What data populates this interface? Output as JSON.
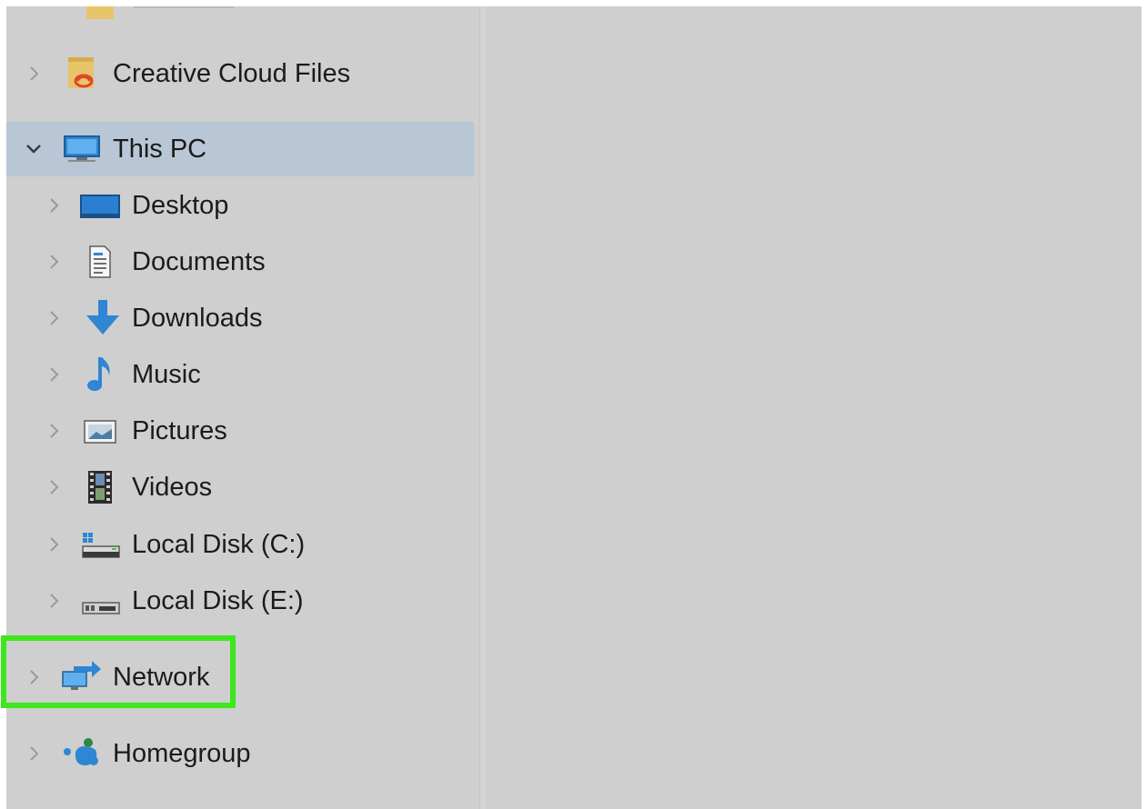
{
  "nav": {
    "partial_item": {
      "icon": "folder-icon"
    },
    "creative_cloud": {
      "label": "Creative Cloud Files",
      "icon": "creative-cloud-folder-icon"
    },
    "this_pc": {
      "label": "This PC",
      "icon": "monitor-icon",
      "expanded": true,
      "selected": true
    },
    "children": [
      {
        "label": "Desktop",
        "icon": "desktop-icon"
      },
      {
        "label": "Documents",
        "icon": "documents-icon"
      },
      {
        "label": "Downloads",
        "icon": "download-arrow-icon"
      },
      {
        "label": "Music",
        "icon": "music-note-icon"
      },
      {
        "label": "Pictures",
        "icon": "pictures-icon"
      },
      {
        "label": "Videos",
        "icon": "videos-icon"
      },
      {
        "label": "Local Disk (C:)",
        "icon": "windows-drive-icon"
      },
      {
        "label": "Local Disk (E:)",
        "icon": "drive-icon"
      }
    ],
    "network": {
      "label": "Network",
      "icon": "network-icon",
      "highlighted": true
    },
    "homegroup": {
      "label": "Homegroup",
      "icon": "homegroup-icon"
    }
  },
  "colors": {
    "pane_bg": "#cfcfcf",
    "selection_bg": "#b9c6d5",
    "highlight_border": "#3ee61d",
    "accent_blue": "#2f86d2"
  }
}
